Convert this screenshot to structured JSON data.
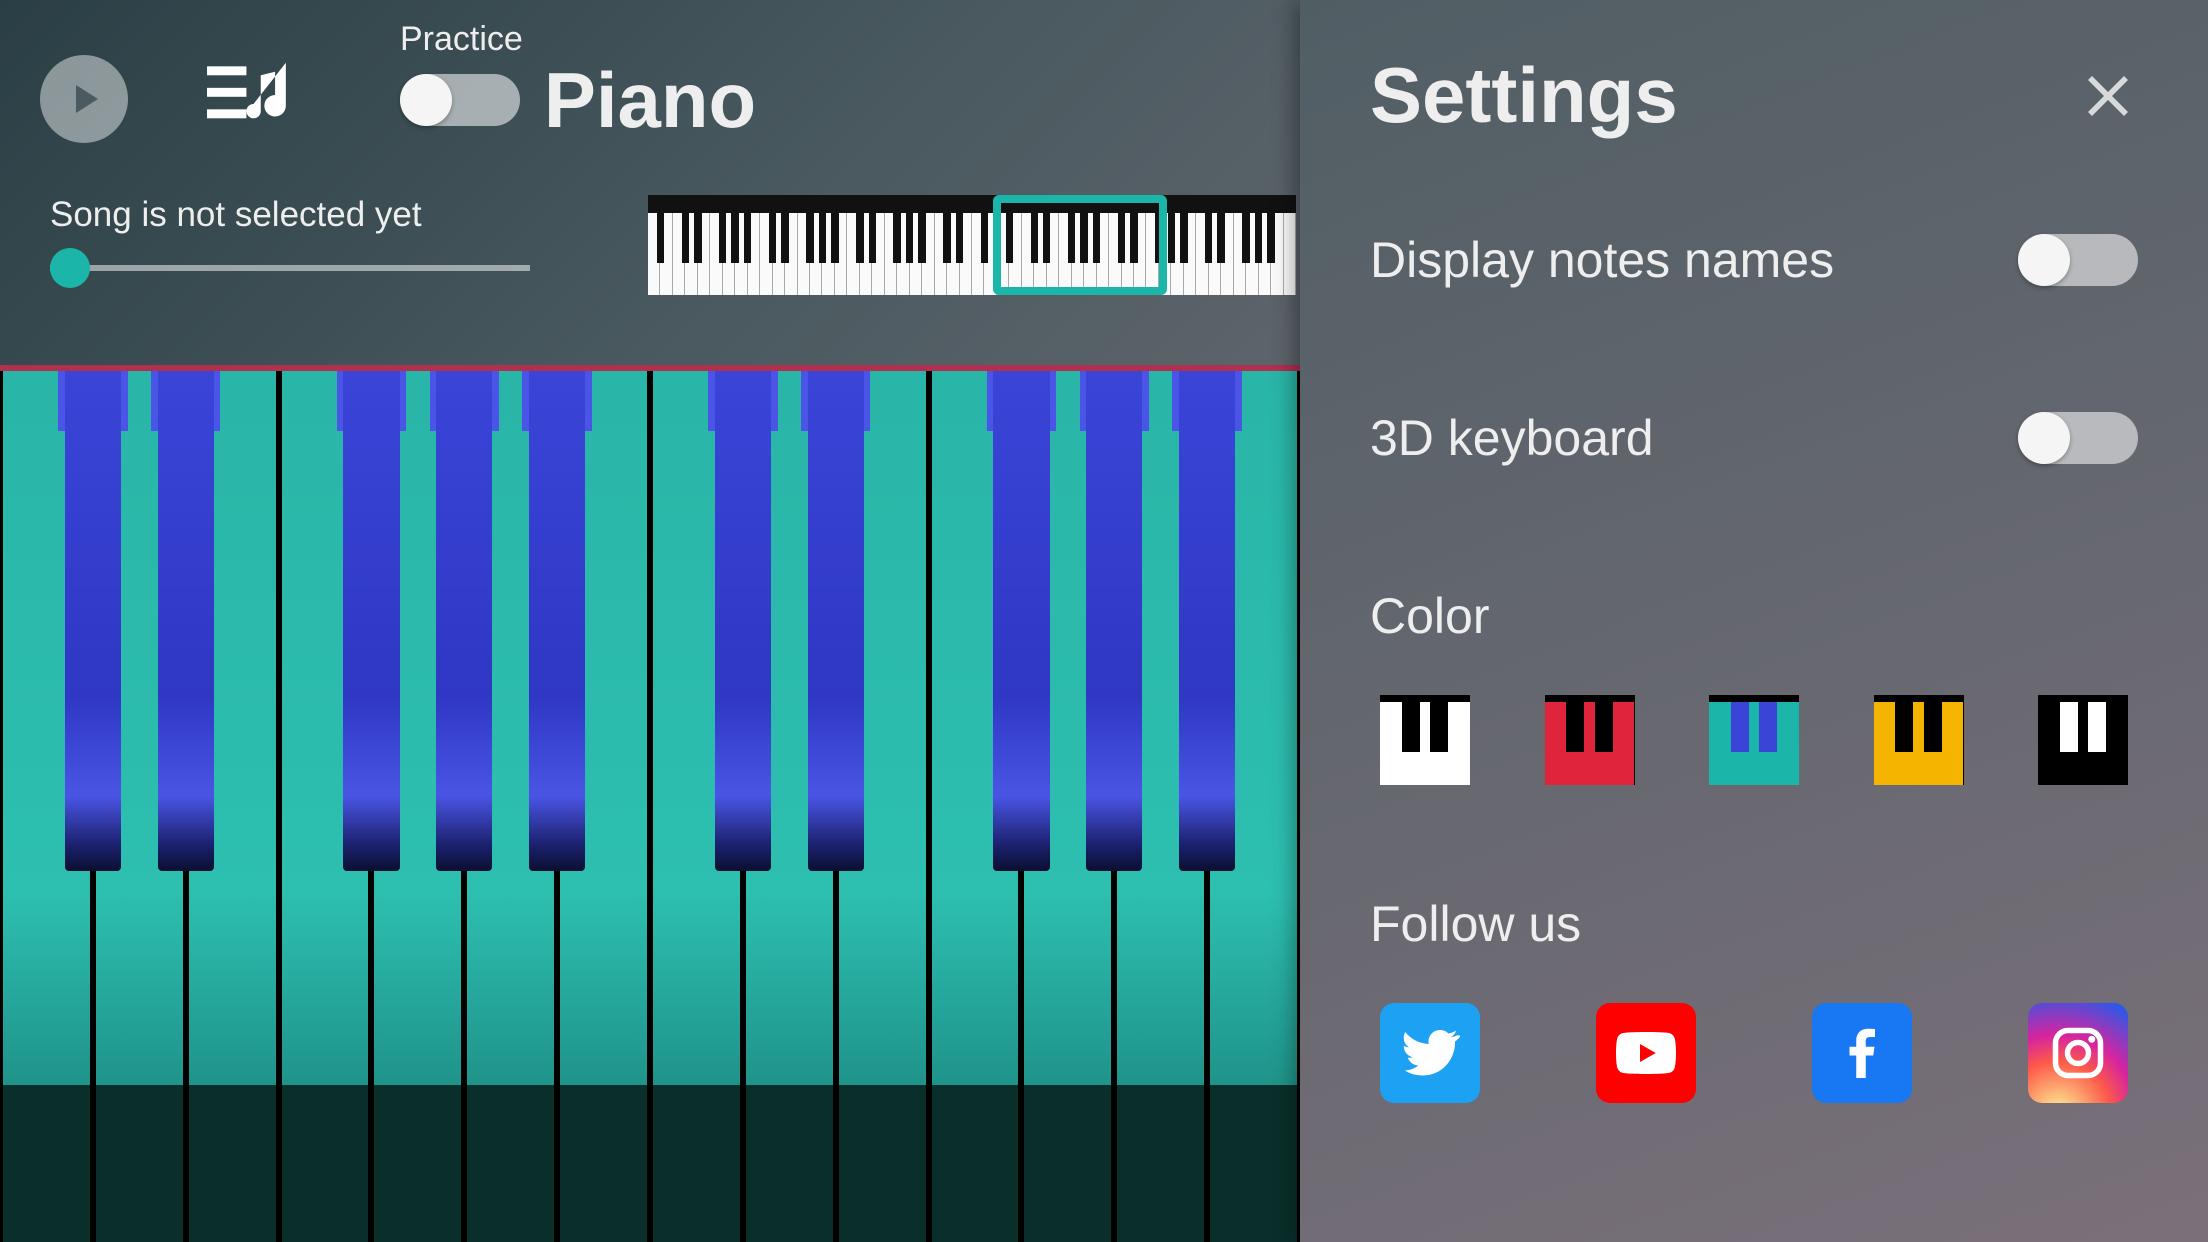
{
  "header": {
    "title": "Piano",
    "practice_label": "Practice",
    "practice_on": false
  },
  "song": {
    "status_text": "Song is not selected yet",
    "progress": 0
  },
  "minimap": {
    "total_white_keys": 52,
    "viewport_start_key": 28,
    "viewport_key_count": 14
  },
  "keyboard": {
    "visible_white_keys": 14,
    "visible_start_note": "C4",
    "white_color": "#29b5a7",
    "black_color": "#3a45d8"
  },
  "settings": {
    "title": "Settings",
    "options": {
      "display_notes_names": {
        "label": "Display notes names",
        "value": false
      },
      "keyboard_3d": {
        "label": "3D keyboard",
        "value": false
      }
    },
    "color_section": "Color",
    "color_themes": [
      {
        "id": "classic",
        "white": "#ffffff",
        "black": "#000000"
      },
      {
        "id": "red",
        "white": "#e0243b",
        "black": "#000000"
      },
      {
        "id": "teal",
        "white": "#1bb6a9",
        "black": "#3a45d8",
        "selected": true
      },
      {
        "id": "yellow",
        "white": "#f5b400",
        "black": "#000000"
      },
      {
        "id": "dark",
        "white": "#000000",
        "black": "#ffffff"
      }
    ],
    "follow_section": "Follow us",
    "socials": [
      "twitter",
      "youtube",
      "facebook",
      "instagram"
    ]
  }
}
